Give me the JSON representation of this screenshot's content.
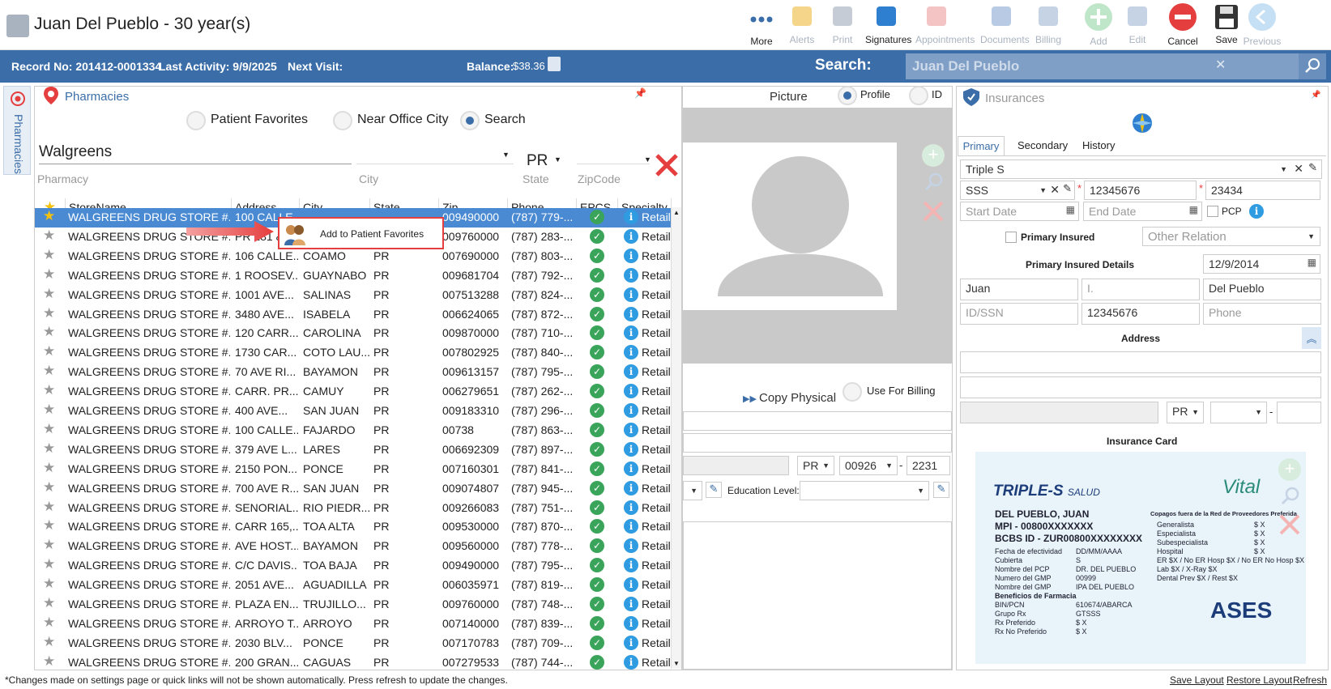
{
  "header": {
    "title": "Juan Del Pueblo - 30 year(s)",
    "toolbar": [
      {
        "label": "More",
        "icon": "more-icon",
        "disabled": false
      },
      {
        "label": "Alerts",
        "icon": "bell-icon",
        "disabled": true
      },
      {
        "label": "Print",
        "icon": "printer-icon",
        "disabled": true
      },
      {
        "label": "Signatures",
        "icon": "pen-icon",
        "disabled": false
      },
      {
        "label": "Appointments",
        "icon": "calendar-icon",
        "disabled": true
      },
      {
        "label": "Documents",
        "icon": "documents-icon",
        "disabled": true
      },
      {
        "label": "Billing",
        "icon": "billing-icon",
        "disabled": true
      },
      {
        "label": "Add",
        "icon": "add-icon",
        "disabled": true
      },
      {
        "label": "Edit",
        "icon": "edit-icon",
        "disabled": true
      },
      {
        "label": "Cancel",
        "icon": "cancel-icon",
        "disabled": false
      },
      {
        "label": "Save",
        "icon": "save-icon",
        "disabled": false
      },
      {
        "label": "Previous",
        "icon": "back-arrow-icon",
        "disabled": true
      }
    ]
  },
  "infobar": {
    "record": "Record No: 201412-0001334",
    "last_activity": "Last Activity: 9/9/2025",
    "next_visit": "Next Visit:",
    "balance_label": "Balance:",
    "balance_value": "$38.36",
    "search_label": "Search:",
    "search_value": "Juan Del Pueblo"
  },
  "sidetab": {
    "label": "Pharmacies"
  },
  "pharmacies": {
    "title": "Pharmacies",
    "radios": [
      {
        "label": "Patient Favorites",
        "checked": false
      },
      {
        "label": "Near Office City",
        "checked": false
      },
      {
        "label": "Search",
        "checked": true
      }
    ],
    "filters": {
      "pharmacy_value": "Walgreens",
      "pharmacy_label": "Pharmacy",
      "city_label": "City",
      "state_value": "PR",
      "state_label": "State",
      "zip_label": "ZipCode"
    },
    "columns": [
      "StoreName",
      "Address",
      "City",
      "State",
      "Zip",
      "Phone",
      "EPCS",
      "Specialty"
    ],
    "rows": [
      {
        "store": "WALGREENS DRUG STORE #...",
        "address": "100 CALLE...",
        "city": "",
        "state": "",
        "zip": "009490000",
        "phone": "(787) 779-...",
        "specialty": "Retail",
        "fav": true,
        "selected": true
      },
      {
        "store": "WALGREENS DRUG STORE #...",
        "address": "PR 181 &...",
        "city": "",
        "state": "",
        "zip": "009760000",
        "phone": "(787) 283-...",
        "specialty": "Retail",
        "fav": false
      },
      {
        "store": "WALGREENS DRUG STORE #...",
        "address": "106 CALLE...",
        "city": "COAMO",
        "state": "PR",
        "zip": "007690000",
        "phone": "(787) 803-...",
        "specialty": "Retail",
        "fav": false
      },
      {
        "store": "WALGREENS DRUG STORE #...",
        "address": "1 ROOSEV...",
        "city": "GUAYNABO",
        "state": "PR",
        "zip": "009681704",
        "phone": "(787) 792-...",
        "specialty": "Retail",
        "fav": false
      },
      {
        "store": "WALGREENS DRUG STORE #...",
        "address": "1001 AVE...",
        "city": "SALINAS",
        "state": "PR",
        "zip": "007513288",
        "phone": "(787) 824-...",
        "specialty": "Retail",
        "fav": false
      },
      {
        "store": "WALGREENS DRUG STORE #...",
        "address": "3480 AVE...",
        "city": "ISABELA",
        "state": "PR",
        "zip": "006624065",
        "phone": "(787) 872-...",
        "specialty": "Retail",
        "fav": false
      },
      {
        "store": "WALGREENS DRUG STORE #...",
        "address": "120 CARR...",
        "city": "CAROLINA",
        "state": "PR",
        "zip": "009870000",
        "phone": "(787) 710-...",
        "specialty": "Retail",
        "fav": false
      },
      {
        "store": "WALGREENS DRUG STORE #...",
        "address": "1730 CAR...",
        "city": "COTO LAU...",
        "state": "PR",
        "zip": "007802925",
        "phone": "(787) 840-...",
        "specialty": "Retail",
        "fav": false
      },
      {
        "store": "WALGREENS DRUG STORE #...",
        "address": "70 AVE RI...",
        "city": "BAYAMON",
        "state": "PR",
        "zip": "009613157",
        "phone": "(787) 795-...",
        "specialty": "Retail",
        "fav": false
      },
      {
        "store": "WALGREENS DRUG STORE #...",
        "address": "CARR. PR...",
        "city": "CAMUY",
        "state": "PR",
        "zip": "006279651",
        "phone": "(787) 262-...",
        "specialty": "Retail",
        "fav": false
      },
      {
        "store": "WALGREENS DRUG STORE #...",
        "address": "400 AVE...",
        "city": "SAN JUAN",
        "state": "PR",
        "zip": "009183310",
        "phone": "(787) 296-...",
        "specialty": "Retail",
        "fav": false
      },
      {
        "store": "WALGREENS DRUG STORE #...",
        "address": "100 CALLE...",
        "city": "FAJARDO",
        "state": "PR",
        "zip": "00738",
        "phone": "(787) 863-...",
        "specialty": "Retail",
        "fav": false
      },
      {
        "store": "WALGREENS DRUG STORE #...",
        "address": "379 AVE L...",
        "city": "LARES",
        "state": "PR",
        "zip": "006692309",
        "phone": "(787) 897-...",
        "specialty": "Retail",
        "fav": false
      },
      {
        "store": "WALGREENS DRUG STORE #...",
        "address": "2150 PON...",
        "city": "PONCE",
        "state": "PR",
        "zip": "007160301",
        "phone": "(787) 841-...",
        "specialty": "Retail",
        "fav": false
      },
      {
        "store": "WALGREENS DRUG STORE #...",
        "address": "700 AVE R...",
        "city": "SAN JUAN",
        "state": "PR",
        "zip": "009074807",
        "phone": "(787) 945-...",
        "specialty": "Retail",
        "fav": false
      },
      {
        "store": "WALGREENS DRUG STORE #...",
        "address": "SENORIAL...",
        "city": "RIO PIEDR...",
        "state": "PR",
        "zip": "009266083",
        "phone": "(787) 751-...",
        "specialty": "Retail",
        "fav": false
      },
      {
        "store": "WALGREENS DRUG STORE #...",
        "address": "CARR 165,...",
        "city": "TOA ALTA",
        "state": "PR",
        "zip": "009530000",
        "phone": "(787) 870-...",
        "specialty": "Retail",
        "fav": false
      },
      {
        "store": "WALGREENS DRUG STORE #...",
        "address": "AVE HOST...",
        "city": "BAYAMON",
        "state": "PR",
        "zip": "009560000",
        "phone": "(787) 778-...",
        "specialty": "Retail",
        "fav": false
      },
      {
        "store": "WALGREENS DRUG STORE #...",
        "address": "C/C DAVIS...",
        "city": "TOA BAJA",
        "state": "PR",
        "zip": "009490000",
        "phone": "(787) 795-...",
        "specialty": "Retail",
        "fav": false
      },
      {
        "store": "WALGREENS DRUG STORE #...",
        "address": "2051 AVE...",
        "city": "AGUADILLA",
        "state": "PR",
        "zip": "006035971",
        "phone": "(787) 819-...",
        "specialty": "Retail",
        "fav": false
      },
      {
        "store": "WALGREENS DRUG STORE #...",
        "address": "PLAZA EN...",
        "city": "TRUJILLO...",
        "state": "PR",
        "zip": "009760000",
        "phone": "(787) 748-...",
        "specialty": "Retail",
        "fav": false
      },
      {
        "store": "WALGREENS DRUG STORE #...",
        "address": "ARROYO T...",
        "city": "ARROYO",
        "state": "PR",
        "zip": "007140000",
        "phone": "(787) 839-...",
        "specialty": "Retail",
        "fav": false
      },
      {
        "store": "WALGREENS DRUG STORE #...",
        "address": "2030 BLV...",
        "city": "PONCE",
        "state": "PR",
        "zip": "007170783",
        "phone": "(787) 709-...",
        "specialty": "Retail",
        "fav": false
      },
      {
        "store": "WALGREENS DRUG STORE #...",
        "address": "200 GRAN...",
        "city": "CAGUAS",
        "state": "PR",
        "zip": "007279533",
        "phone": "(787) 744-...",
        "specialty": "Retail",
        "fav": false
      }
    ],
    "context_menu_item": "Add to Patient Favorites"
  },
  "picture": {
    "label": "Picture",
    "profile_label": "Profile",
    "id_label": "ID",
    "copy_physical": "Copy Physical",
    "use_for_billing": "Use For Billing",
    "state_value": "PR",
    "zip_value": "00926",
    "zip_ext": "2231",
    "education_label": "Education Level:"
  },
  "insurances": {
    "title": "Insurances",
    "tabs": [
      "Primary",
      "Secondary",
      "History"
    ],
    "plan": "Triple S",
    "payer": "SSS",
    "member_id": "12345676",
    "group": "23434",
    "start_date_ph": "Start Date",
    "end_date_ph": "End Date",
    "pcp_label": "PCP",
    "primary_insured_label": "Primary Insured",
    "other_relation_ph": "Other Relation",
    "details_label": "Primary Insured Details",
    "dob": "12/9/2014",
    "first_name": "Juan",
    "middle_ph": "I.",
    "last_name": "Del Pueblo",
    "idssn_ph": "ID/SSN",
    "id_value": "12345676",
    "phone_ph": "Phone",
    "address_label": "Address",
    "state_value": "PR",
    "card_label": "Insurance Card",
    "card": {
      "brand": "TRIPLE-S",
      "brand_sub": "SALUD",
      "vital": "Vital",
      "name": "DEL PUEBLO, JUAN",
      "mpi": "MPI - 00800XXXXXXX",
      "bcbs": "BCBS ID - ZUR00800XXXXXXXX",
      "ases": "ASES",
      "copagos": "Copagos fuera de la Red de Proveedores Preferida",
      "left_labels": [
        "Fecha de efectividad",
        "Cubierta",
        "Nombre del PCP",
        "Numero del GMP",
        "Nombre del GMP",
        "Beneficios de Farmacia",
        "BIN/PCN",
        "Grupo Rx",
        "Rx Preferido",
        "Rx No Preferido"
      ],
      "left_values": [
        "DD/MM/AAAA",
        "S",
        "DR. DEL PUEBLO",
        "00999",
        "IPA DEL PUEBLO",
        "",
        "610674/ABARCA",
        "GTSSS",
        "$ X",
        "$ X"
      ],
      "right_labels": [
        "Generalista",
        "Especialista",
        "Subespecialista",
        "Hospital",
        "ER $X / No ER Hosp $X / No ER No Hosp $X",
        "Lab $X / X-Ray $X",
        "Dental Prev $X / Rest $X"
      ],
      "right_values": [
        "$ X",
        "$ X",
        "$ X",
        "$ X",
        "",
        "",
        ""
      ]
    }
  },
  "footer": {
    "note": "*Changes made on settings page or quick links will not be shown automatically. Press refresh to update the changes.",
    "save_layout": "Save Layout",
    "restore_layout": "Restore Layout",
    "refresh": "Refresh"
  }
}
